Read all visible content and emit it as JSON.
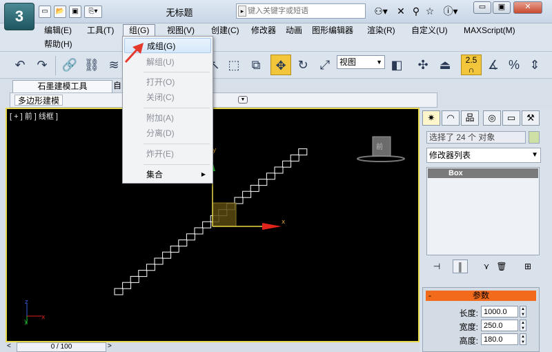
{
  "window": {
    "title": "无标题",
    "app_logo": "3",
    "search_placeholder": "键入关键字或短语"
  },
  "menubar": {
    "items": [
      "编辑(E)",
      "工具(T)",
      "组(G)",
      "视图(V)",
      "创建(C)",
      "修改器",
      "动画",
      "图形编辑器",
      "渲染(R)",
      "自定义(U)",
      "MAXScript(M)",
      "帮助(H)"
    ]
  },
  "toolbar": {
    "view_dropdown": "视图",
    "snap_value": "2.5"
  },
  "ribbon": {
    "tab_active": "石墨建模工具",
    "tab_other": "自",
    "panel_tab": "多边形建模"
  },
  "viewport": {
    "label": "[ + ] 前 ] 线框 ]",
    "axis_x": "x",
    "axis_y": "y",
    "gizmo_x": "x",
    "gizmo_y": "y",
    "gizmo_z": "z"
  },
  "timeline": {
    "frame": "0 / 100"
  },
  "command_panel": {
    "selection_info": "选择了 24 个 对象",
    "modifier_list": "修改器列表",
    "stack_item": "Box",
    "params_title": "参数",
    "params": [
      {
        "label": "长度:",
        "value": "1000.0"
      },
      {
        "label": "宽度:",
        "value": "250.0"
      },
      {
        "label": "高度:",
        "value": "180.0"
      }
    ]
  },
  "group_menu": {
    "items": [
      {
        "label": "成组(G)",
        "enabled": true
      },
      {
        "label": "解组(U)",
        "enabled": false
      },
      {
        "label": "打开(O)",
        "enabled": false
      },
      {
        "label": "关闭(C)",
        "enabled": false
      },
      {
        "label": "附加(A)",
        "enabled": false
      },
      {
        "label": "分离(D)",
        "enabled": false
      },
      {
        "label": "炸开(E)",
        "enabled": false
      },
      {
        "label": "集合",
        "enabled": true
      }
    ]
  },
  "colors": {
    "viewport_border": "#e8d84c",
    "params_header": "#f26a1c",
    "annotation_arrow": "#e53a2e"
  }
}
